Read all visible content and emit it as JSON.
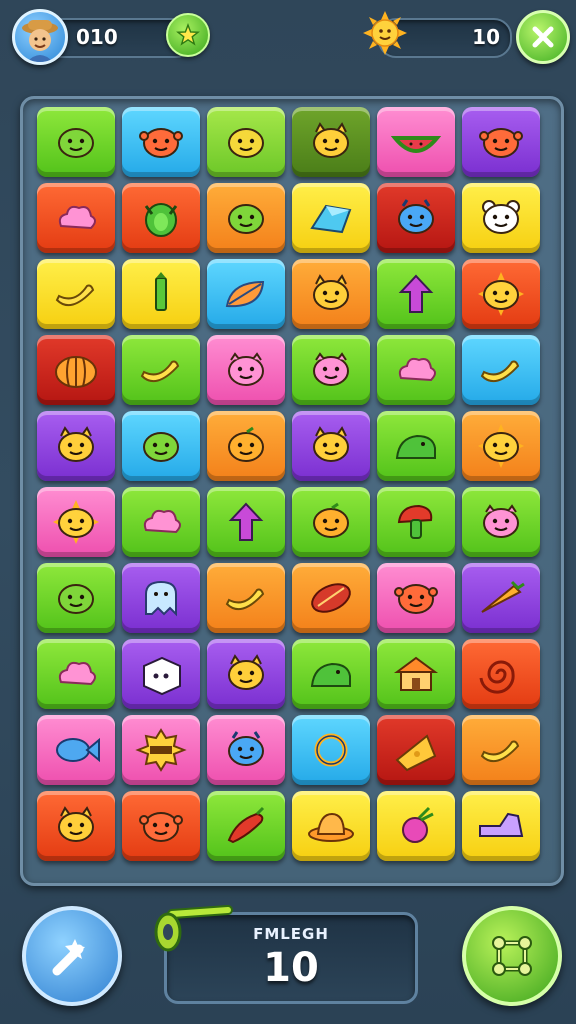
{
  "hud": {
    "left_counter": "010",
    "right_counter": "10",
    "avatar_icon": "player-avatar-icon",
    "star_icon": "star-icon",
    "sun_icon": "sun-icon",
    "close_icon": "close-icon"
  },
  "board": {
    "rows": 10,
    "cols": 6,
    "tiles": [
      [
        {
          "color": "green",
          "icon": "slime"
        },
        {
          "color": "cyan",
          "icon": "crab"
        },
        {
          "color": "lime",
          "icon": "lemon"
        },
        {
          "color": "olive",
          "icon": "cat"
        },
        {
          "color": "pink",
          "icon": "watermelon"
        },
        {
          "color": "purple",
          "icon": "crab"
        }
      ],
      [
        {
          "color": "red",
          "icon": "cloud"
        },
        {
          "color": "red",
          "icon": "bug"
        },
        {
          "color": "orange",
          "icon": "slime"
        },
        {
          "color": "yellow",
          "icon": "crystal"
        },
        {
          "color": "dred",
          "icon": "monster"
        },
        {
          "color": "yellow",
          "icon": "bear"
        }
      ],
      [
        {
          "color": "yellow",
          "icon": "banana"
        },
        {
          "color": "yellow",
          "icon": "pencil"
        },
        {
          "color": "cyan",
          "icon": "leaf"
        },
        {
          "color": "orange",
          "icon": "cat"
        },
        {
          "color": "green",
          "icon": "arrow"
        },
        {
          "color": "red",
          "icon": "sun"
        }
      ],
      [
        {
          "color": "dred",
          "icon": "pumpkin"
        },
        {
          "color": "green",
          "icon": "banana"
        },
        {
          "color": "pink",
          "icon": "pig"
        },
        {
          "color": "green",
          "icon": "pig"
        },
        {
          "color": "green",
          "icon": "cloud"
        },
        {
          "color": "cyan",
          "icon": "banana"
        }
      ],
      [
        {
          "color": "purple",
          "icon": "cat"
        },
        {
          "color": "cyan",
          "icon": "slime"
        },
        {
          "color": "orange",
          "icon": "orange"
        },
        {
          "color": "purple",
          "icon": "cat"
        },
        {
          "color": "green",
          "icon": "dino"
        },
        {
          "color": "orange",
          "icon": "sun"
        }
      ],
      [
        {
          "color": "pink",
          "icon": "sun"
        },
        {
          "color": "green",
          "icon": "cloud"
        },
        {
          "color": "green",
          "icon": "arrow"
        },
        {
          "color": "green",
          "icon": "orange"
        },
        {
          "color": "green",
          "icon": "mushroom"
        },
        {
          "color": "green",
          "icon": "pig"
        }
      ],
      [
        {
          "color": "green",
          "icon": "slime"
        },
        {
          "color": "purple",
          "icon": "ghost"
        },
        {
          "color": "orange",
          "icon": "banana"
        },
        {
          "color": "orange",
          "icon": "melon"
        },
        {
          "color": "pink",
          "icon": "crab"
        },
        {
          "color": "purple",
          "icon": "carrot"
        }
      ],
      [
        {
          "color": "green",
          "icon": "cloud"
        },
        {
          "color": "purple",
          "icon": "box"
        },
        {
          "color": "purple",
          "icon": "cat"
        },
        {
          "color": "green",
          "icon": "dino"
        },
        {
          "color": "green",
          "icon": "house"
        },
        {
          "color": "red",
          "icon": "swirl"
        }
      ],
      [
        {
          "color": "pink",
          "icon": "fish"
        },
        {
          "color": "pink",
          "icon": "badge"
        },
        {
          "color": "pink",
          "icon": "monster"
        },
        {
          "color": "cyan",
          "icon": "ring"
        },
        {
          "color": "dred",
          "icon": "cheese"
        },
        {
          "color": "orange",
          "icon": "banana"
        }
      ],
      [
        {
          "color": "red",
          "icon": "cat"
        },
        {
          "color": "red",
          "icon": "crab"
        },
        {
          "color": "green",
          "icon": "chili"
        },
        {
          "color": "yellow",
          "icon": "hat"
        },
        {
          "color": "yellow",
          "icon": "radish"
        },
        {
          "color": "yellow",
          "icon": "shoe"
        }
      ]
    ]
  },
  "bottom": {
    "left_button_icon": "magic-wand-icon",
    "right_button_icon": "shuffle-icon",
    "key_icon": "key-icon",
    "panel_label": "FMLEGH",
    "panel_value": "10"
  },
  "colors": {
    "green": "#6cd02a",
    "lime": "#8ddc3a",
    "olive": "#5e9222",
    "cyan": "#3cc0f2",
    "pink": "#f66fc0",
    "purple": "#9146e0",
    "red": "#f25224",
    "dred": "#cc2a1f",
    "orange": "#f9962a",
    "yellow": "#f9df2c"
  }
}
